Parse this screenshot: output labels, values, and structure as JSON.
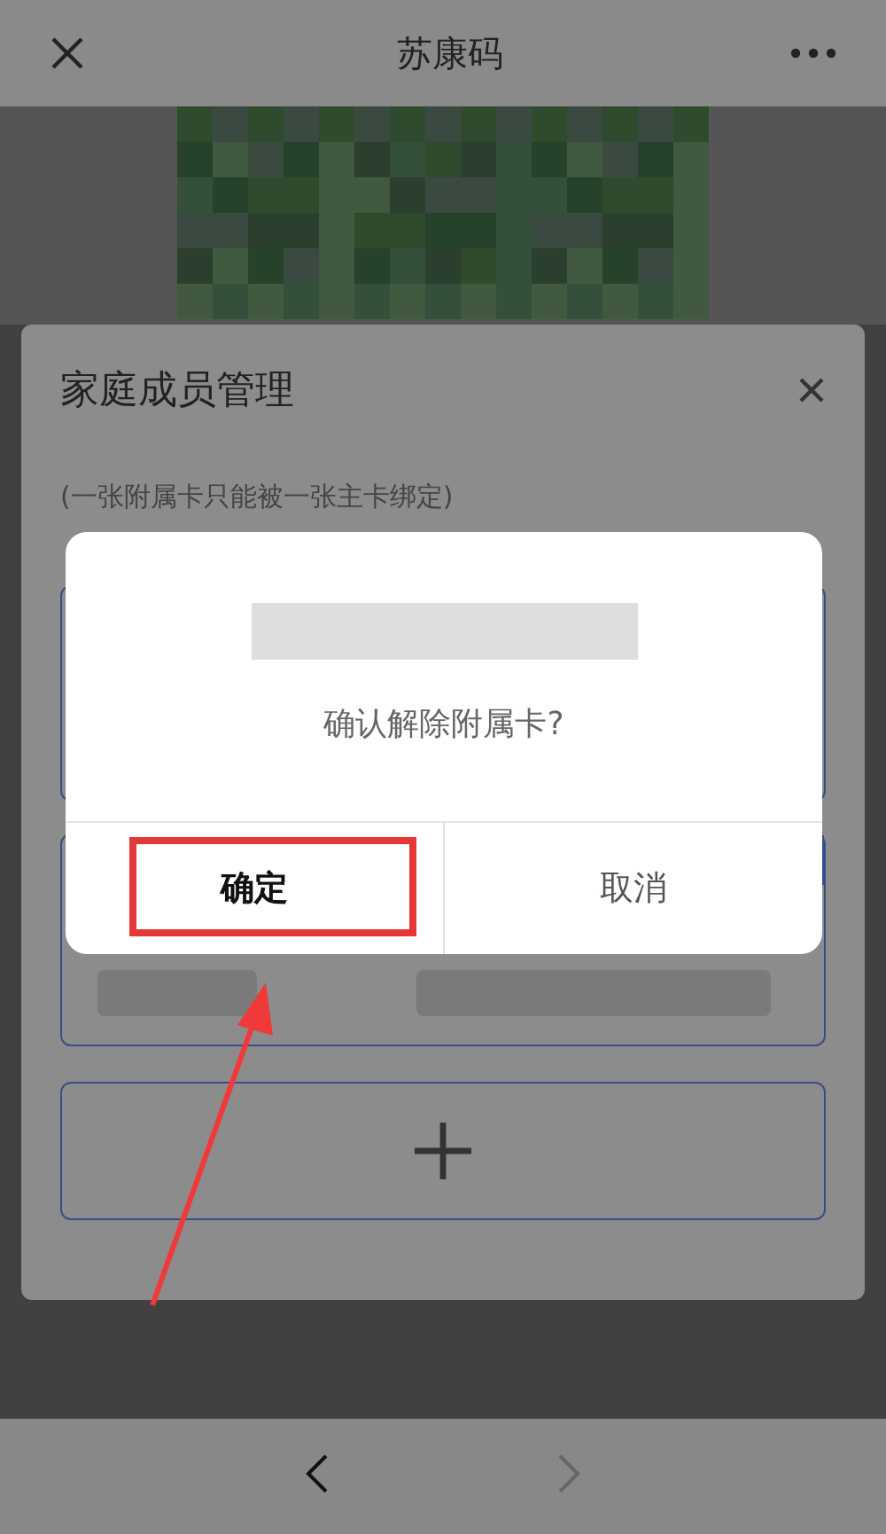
{
  "header": {
    "title": "苏康码"
  },
  "sheet": {
    "title": "家庭成员管理",
    "note": "(一张附属卡只能被一张主卡绑定)"
  },
  "dialog": {
    "message": "确认解除附属卡?",
    "buttons": [
      {
        "label": "确定",
        "kind": "primary",
        "highlighted": true
      },
      {
        "label": "取消",
        "kind": "secondary",
        "highlighted": false
      }
    ]
  },
  "nav": [
    {
      "kind": "back",
      "disabled": false
    },
    {
      "kind": "forward",
      "disabled": true
    }
  ]
}
